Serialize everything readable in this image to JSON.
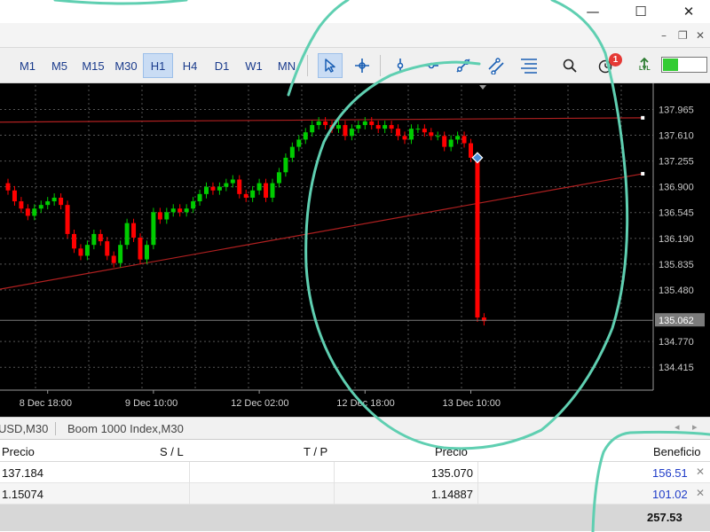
{
  "window": {
    "minimize_glyph": "—",
    "maximize_glyph": "☐",
    "close_glyph": "✕",
    "mdi_minimize_glyph": "–",
    "mdi_restore_glyph": "❐",
    "mdi_close_glyph": "✕"
  },
  "toolbar": {
    "timeframes": [
      "M1",
      "M5",
      "M15",
      "M30",
      "H1",
      "H4",
      "D1",
      "W1",
      "MN"
    ],
    "active_timeframe": "H1",
    "tools": [
      "cursor-icon",
      "crosshair-icon",
      "vertical-line-icon",
      "horizontal-line-icon",
      "trendline-icon",
      "channel-icon",
      "fibonacci-icon",
      "search-icon",
      "alarm-icon",
      "level-icon"
    ],
    "active_tool": "cursor-icon",
    "notification_count": "1",
    "level_label": "LVL",
    "meter_level": 0.35,
    "meter_color": "#33cc33"
  },
  "chart_data": {
    "type": "candlestick",
    "background": "#000000",
    "grid": true,
    "grid_color": "#555555",
    "bull_color": "#00cc00",
    "bear_color": "#ff0000",
    "price_labels": [
      "137.965",
      "137.610",
      "137.255",
      "136.900",
      "136.545",
      "136.190",
      "135.835",
      "135.480",
      "134.770",
      "134.415"
    ],
    "price_axis_values": [
      137.965,
      137.61,
      137.255,
      136.9,
      136.545,
      136.19,
      135.835,
      135.48,
      134.77,
      134.415
    ],
    "ylim": [
      134.1,
      138.3
    ],
    "current_price": "135.062",
    "current_price_value": 135.062,
    "date_labels": [
      "8 Dec 18:00",
      "9 Dec 10:00",
      "12 Dec 02:00",
      "12 Dec 18:00",
      "13 Dec 10:00"
    ],
    "date_label_bar_index": [
      6,
      22,
      38,
      54,
      70
    ],
    "bar_count": 76,
    "first_bar_close": 136.95,
    "closes": [
      136.85,
      136.7,
      136.6,
      136.5,
      136.6,
      136.65,
      136.7,
      136.75,
      136.65,
      136.25,
      136.05,
      135.95,
      136.1,
      136.25,
      136.15,
      135.95,
      135.85,
      136.1,
      136.4,
      136.2,
      135.9,
      136.1,
      136.55,
      136.45,
      136.55,
      136.6,
      136.55,
      136.6,
      136.7,
      136.8,
      136.9,
      136.85,
      136.9,
      136.95,
      137.0,
      136.8,
      136.75,
      136.85,
      136.95,
      136.75,
      136.95,
      137.1,
      137.3,
      137.45,
      137.55,
      137.65,
      137.75,
      137.8,
      137.75,
      137.7,
      137.75,
      137.6,
      137.7,
      137.75,
      137.8,
      137.75,
      137.7,
      137.75,
      137.7,
      137.6,
      137.55,
      137.7,
      137.7,
      137.65,
      137.6,
      137.6,
      137.45,
      137.55,
      137.6,
      137.5,
      137.3,
      135.1,
      135.05
    ],
    "lines": [
      {
        "name": "",
        "color": "#b02020",
        "from": [
          0,
          137.79
        ],
        "to": [
          96,
          137.85
        ]
      },
      {
        "name": "",
        "color": "#b02020",
        "from": [
          0,
          135.49
        ],
        "to": [
          96,
          137.08
        ]
      }
    ]
  },
  "symbols": {
    "tab1": "USD,M30",
    "tab2": "Boom 1000 Index,M30",
    "prev_glyph": "◂",
    "next_glyph": "▸"
  },
  "trades": {
    "headers": {
      "price_open": "Precio",
      "sl": "S / L",
      "tp": "T / P",
      "price_current": "Precio",
      "profit": "Beneficio"
    },
    "rows": [
      {
        "price_open": "137.184",
        "sl": "",
        "tp": "",
        "price_current": "135.070",
        "profit": "156.51"
      },
      {
        "price_open": "1.15074",
        "sl": "",
        "tp": "",
        "price_current": "1.14887",
        "profit": "101.02"
      }
    ],
    "close_glyph": "✕",
    "total_profit": "257.53"
  },
  "annotation": {
    "color": "#5fcfb1"
  }
}
